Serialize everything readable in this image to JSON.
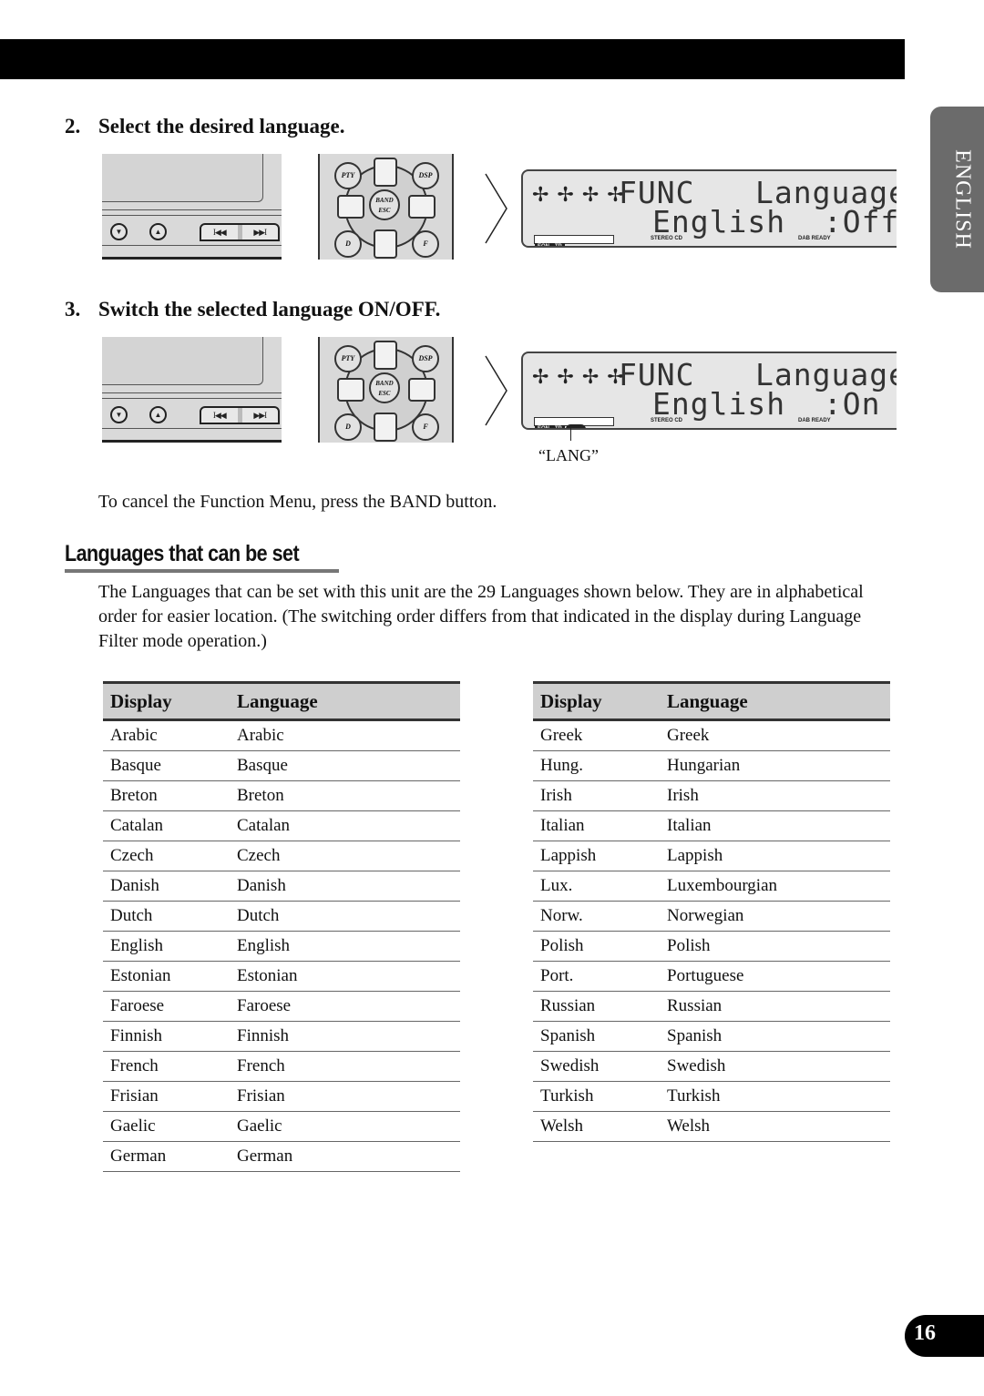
{
  "side_tab": {
    "label": "ENGLISH"
  },
  "steps": [
    {
      "number": "2.",
      "heading": "Select the desired language.",
      "lcd": {
        "func": "FUNC",
        "title": "Language",
        "language": "English",
        "value": ":Off",
        "eon": "EON",
        "tp": "TP",
        "stereo": "STEREO",
        "cd": "CD",
        "dab": "DAB READY"
      }
    },
    {
      "number": "3.",
      "heading": "Switch the selected language ON/OFF.",
      "lcd": {
        "func": "FUNC",
        "title": "Language",
        "language": "English",
        "value": ":On",
        "eon": "EON",
        "tp": "TP",
        "lang": "LANG",
        "stereo": "STEREO",
        "cd": "CD",
        "dab": "DAB READY"
      },
      "callout": "“LANG”"
    }
  ],
  "head_unit": {
    "down_icon": "▼",
    "up_icon": "▲",
    "prev_icon": "I◀◀",
    "next_icon": "▶▶I"
  },
  "remote": {
    "pty": "PTY",
    "dsp": "DSP",
    "band": "BAND",
    "esc": "ESC",
    "d": "D",
    "f": "F"
  },
  "lcd_arrows": "✢ ✢ ✢ ✢",
  "cancel_note": "To cancel the Function Menu, press the BAND button.",
  "section": {
    "title": "Languages that can be set",
    "paragraph": "The Languages that can be set with this unit are the 29 Languages shown below. They are in alphabetical order for easier location. (The switching order differs from that indicated in the display during Language Filter mode operation.)"
  },
  "tables": [
    {
      "headers": [
        "Display",
        "Language"
      ],
      "rows": [
        [
          "Arabic",
          "Arabic"
        ],
        [
          "Basque",
          "Basque"
        ],
        [
          "Breton",
          "Breton"
        ],
        [
          "Catalan",
          "Catalan"
        ],
        [
          "Czech",
          "Czech"
        ],
        [
          "Danish",
          "Danish"
        ],
        [
          "Dutch",
          "Dutch"
        ],
        [
          "English",
          "English"
        ],
        [
          "Estonian",
          "Estonian"
        ],
        [
          "Faroese",
          "Faroese"
        ],
        [
          "Finnish",
          "Finnish"
        ],
        [
          "French",
          "French"
        ],
        [
          "Frisian",
          "Frisian"
        ],
        [
          "Gaelic",
          "Gaelic"
        ],
        [
          "German",
          "German"
        ]
      ]
    },
    {
      "headers": [
        "Display",
        "Language"
      ],
      "rows": [
        [
          "Greek",
          "Greek"
        ],
        [
          "Hung.",
          "Hungarian"
        ],
        [
          "Irish",
          "Irish"
        ],
        [
          "Italian",
          "Italian"
        ],
        [
          "Lappish",
          "Lappish"
        ],
        [
          "Lux.",
          "Luxembourgian"
        ],
        [
          "Norw.",
          "Norwegian"
        ],
        [
          "Polish",
          "Polish"
        ],
        [
          "Port.",
          "Portuguese"
        ],
        [
          "Russian",
          "Russian"
        ],
        [
          "Spanish",
          "Spanish"
        ],
        [
          "Swedish",
          "Swedish"
        ],
        [
          "Turkish",
          "Turkish"
        ],
        [
          "Welsh",
          "Welsh"
        ]
      ]
    }
  ],
  "page_number": "16"
}
